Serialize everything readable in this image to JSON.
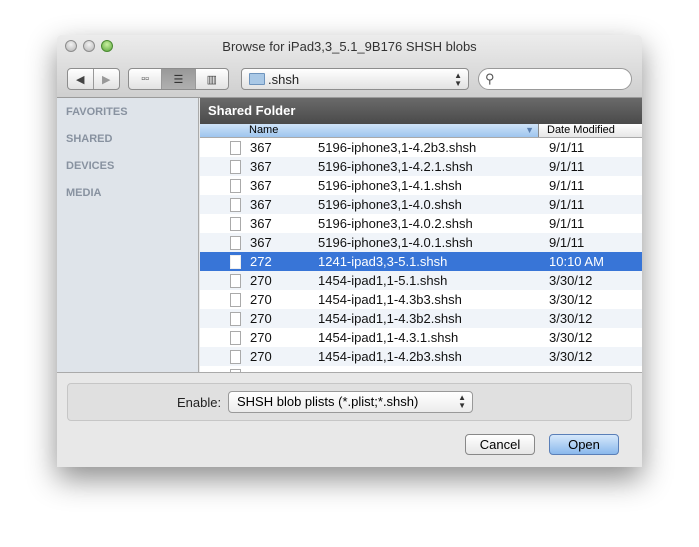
{
  "window": {
    "title": "Browse for iPad3,3_5.1_9B176 SHSH blobs"
  },
  "toolbar": {
    "back": "◀",
    "forward": "▶",
    "view_icons": "▫▫",
    "view_list": "☰",
    "view_columns": "▥",
    "location": ".shsh",
    "search_placeholder": ""
  },
  "sidebar": {
    "items": [
      "FAVORITES",
      "SHARED",
      "DEVICES",
      "MEDIA"
    ]
  },
  "browser": {
    "header": "Shared Folder",
    "columns": {
      "name": "Name",
      "date": "Date Modified"
    },
    "rows": [
      {
        "size": "367",
        "name": "5196-iphone3,1-4.2b3.shsh",
        "date": "9/1/11"
      },
      {
        "size": "367",
        "name": "5196-iphone3,1-4.2.1.shsh",
        "date": "9/1/11"
      },
      {
        "size": "367",
        "name": "5196-iphone3,1-4.1.shsh",
        "date": "9/1/11"
      },
      {
        "size": "367",
        "name": "5196-iphone3,1-4.0.shsh",
        "date": "9/1/11"
      },
      {
        "size": "367",
        "name": "5196-iphone3,1-4.0.2.shsh",
        "date": "9/1/11"
      },
      {
        "size": "367",
        "name": "5196-iphone3,1-4.0.1.shsh",
        "date": "9/1/11"
      },
      {
        "size": "272",
        "name": "1241-ipad3,3-5.1.shsh",
        "date": "10:10 AM",
        "selected": true
      },
      {
        "size": "270",
        "name": "1454-ipad1,1-5.1.shsh",
        "date": "3/30/12"
      },
      {
        "size": "270",
        "name": "1454-ipad1,1-4.3b3.shsh",
        "date": "3/30/12"
      },
      {
        "size": "270",
        "name": "1454-ipad1,1-4.3b2.shsh",
        "date": "3/30/12"
      },
      {
        "size": "270",
        "name": "1454-ipad1,1-4.3.1.shsh",
        "date": "3/30/12"
      },
      {
        "size": "270",
        "name": "1454-ipad1,1-4.2b3.shsh",
        "date": "3/30/12"
      }
    ]
  },
  "footer": {
    "enable_label": "Enable:",
    "enable_value": "SHSH blob plists (*.plist;*.shsh)",
    "cancel": "Cancel",
    "open": "Open"
  }
}
